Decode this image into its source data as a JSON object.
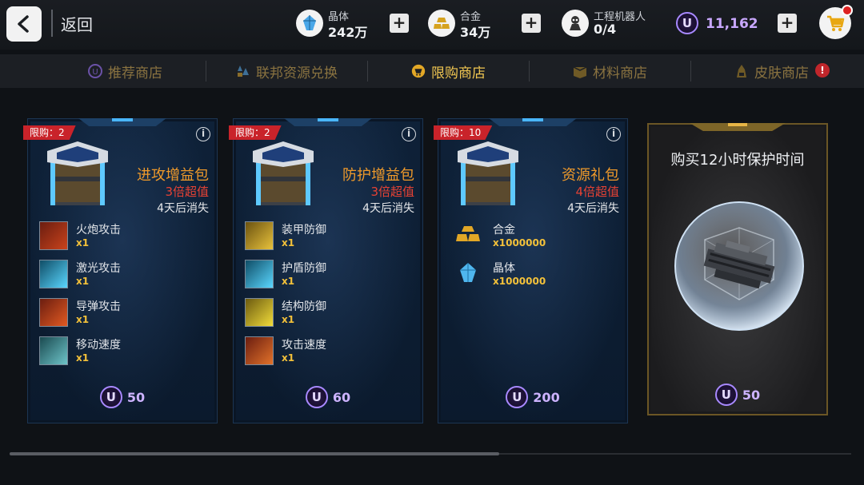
{
  "header": {
    "back_label": "返回",
    "resources": [
      {
        "label": "晶体",
        "value": "242万",
        "icon": "crystal-icon"
      },
      {
        "label": "合金",
        "value": "34万",
        "icon": "alloy-icon"
      },
      {
        "label": "工程机器人",
        "value": "0/4",
        "icon": "robot-icon"
      }
    ],
    "premium_currency": "11,162",
    "premium_currency_symbol": "U"
  },
  "tabs": [
    {
      "label": "推荐商店",
      "icon": "u-coin-icon",
      "active": false
    },
    {
      "label": "联邦资源兑换",
      "icon": "resource-drops-icon",
      "active": false
    },
    {
      "label": "限购商店",
      "icon": "limited-shop-icon",
      "active": true
    },
    {
      "label": "材料商店",
      "icon": "material-crate-icon",
      "active": false
    },
    {
      "label": "皮肤商店",
      "icon": "skin-icon",
      "active": false,
      "badge": "!"
    }
  ],
  "cards": [
    {
      "limit": "限购：2",
      "title": "进攻增益包",
      "multiplier": "3倍超值",
      "expire": "4天后消失",
      "items": [
        {
          "name": "火炮攻击",
          "qty": "x1"
        },
        {
          "name": "激光攻击",
          "qty": "x1"
        },
        {
          "name": "导弹攻击",
          "qty": "x1"
        },
        {
          "name": "移动速度",
          "qty": "x1"
        }
      ],
      "price": "50"
    },
    {
      "limit": "限购：2",
      "title": "防护增益包",
      "multiplier": "3倍超值",
      "expire": "4天后消失",
      "items": [
        {
          "name": "装甲防御",
          "qty": "x1"
        },
        {
          "name": "护盾防御",
          "qty": "x1"
        },
        {
          "name": "结构防御",
          "qty": "x1"
        },
        {
          "name": "攻击速度",
          "qty": "x1"
        }
      ],
      "price": "60"
    },
    {
      "limit": "限购：10",
      "title": "资源礼包",
      "multiplier": "4倍超值",
      "expire": "4天后消失",
      "items": [
        {
          "name": "合金",
          "qty": "x1000000"
        },
        {
          "name": "晶体",
          "qty": "x1000000"
        }
      ],
      "price": "200"
    },
    {
      "title": "购买12小时保护时间",
      "price": "50"
    }
  ],
  "colors": {
    "accent_gold": "#f0c651",
    "pack_title": "#f09a2a",
    "multiplier": "#e64234",
    "limit_tag": "#c9232a",
    "premium": "#cdb3ff"
  }
}
